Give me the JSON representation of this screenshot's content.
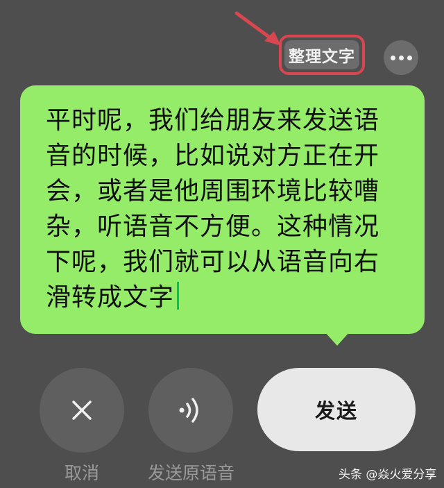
{
  "toolbar": {
    "organize_label": "整理文字",
    "more_icon": "more-horizontal-icon",
    "highlight_color": "#d8474f"
  },
  "bubble": {
    "text": "平时呢，我们给朋友来发送语音的时候，比如说对方正在开会，或者是他周围环境比较嘈杂，听语音不方便。这种情况下呢，我们就可以从语音向右滑转成文字",
    "background_color": "#95ec69"
  },
  "actions": {
    "cancel_label": "取消",
    "cancel_icon": "close-icon",
    "send_original_label": "发送原语音",
    "send_original_icon": "voice-wave-icon",
    "send_label": "发送"
  },
  "watermark": {
    "text": "头条 @焱火爱分享"
  }
}
